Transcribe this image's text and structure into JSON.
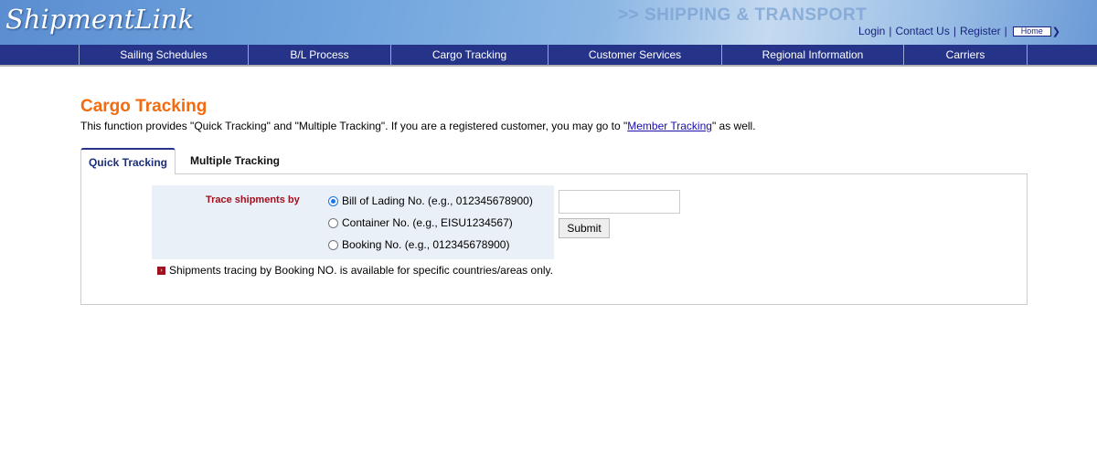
{
  "header": {
    "logo": "ShipmentLink",
    "slogan": ">> SHIPPING & TRANSPORT",
    "links": {
      "login": "Login",
      "contact": "Contact Us",
      "register": "Register",
      "home": "Home"
    },
    "sep": "|"
  },
  "nav": [
    "Sailing Schedules",
    "B/L Process",
    "Cargo Tracking",
    "Customer Services",
    "Regional Information",
    "Carriers"
  ],
  "page": {
    "title": "Cargo Tracking",
    "desc_pre": "This function provides \"Quick Tracking\" and \"Multiple Tracking\". If you are a registered customer, you may go to \"",
    "desc_link": "Member Tracking",
    "desc_post": "\" as well."
  },
  "tabs": {
    "quick": "Quick Tracking",
    "multiple": "Multiple Tracking"
  },
  "form": {
    "label": "Trace shipments by",
    "options": [
      "Bill of Lading No. (e.g., 012345678900)",
      "Container No. (e.g., EISU1234567)",
      "Booking No. (e.g., 012345678900)"
    ],
    "input_value": "",
    "submit": "Submit",
    "note": "Shipments tracing by Booking NO. is available for specific countries/areas only."
  },
  "colors": {
    "nav": "#253488",
    "title": "#f26b10",
    "label": "#a0101e"
  }
}
